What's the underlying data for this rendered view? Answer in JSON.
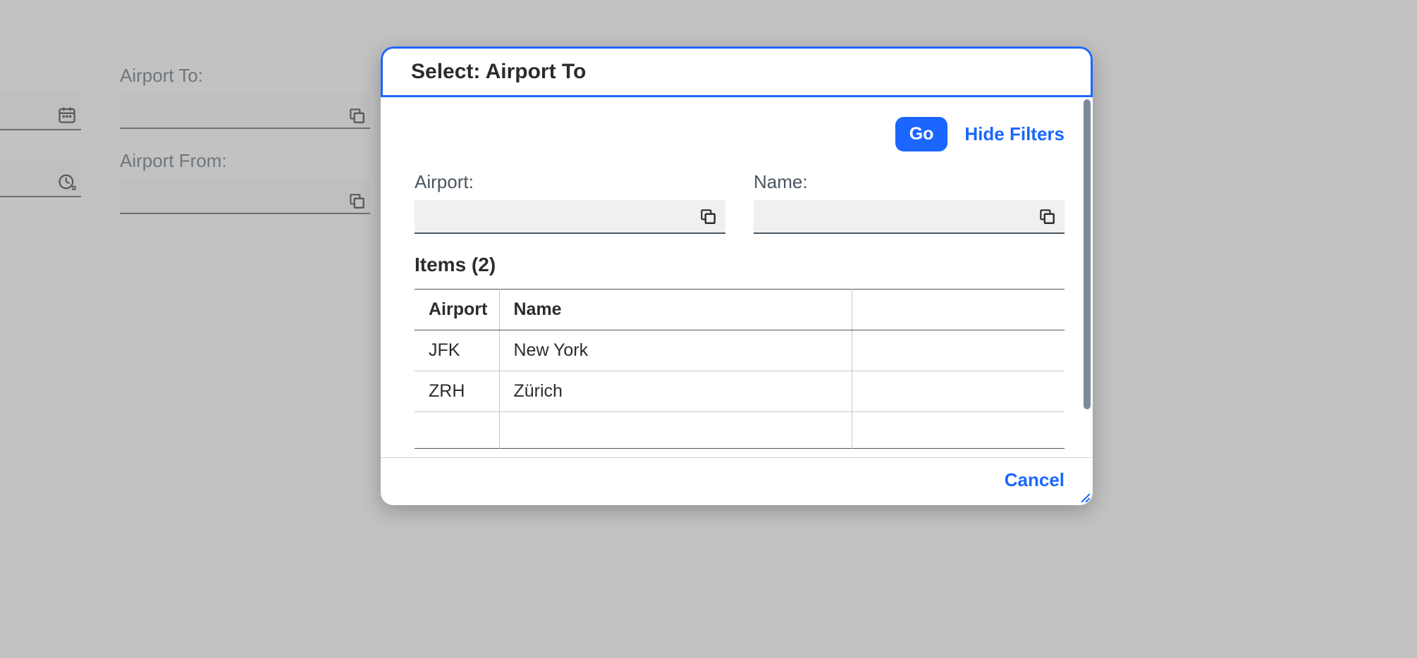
{
  "background": {
    "airport_to_label": "Airport To:",
    "airport_from_label": "Airport From:"
  },
  "dialog": {
    "title": "Select: Airport To",
    "go_label": "Go",
    "hide_filters_label": "Hide Filters",
    "filters": {
      "airport_label": "Airport:",
      "name_label": "Name:"
    },
    "items_heading": "Items (2)",
    "columns": {
      "airport": "Airport",
      "name": "Name"
    },
    "rows": [
      {
        "airport": "JFK",
        "name": "New York"
      },
      {
        "airport": "ZRH",
        "name": "Zürich"
      }
    ],
    "cancel_label": "Cancel"
  }
}
